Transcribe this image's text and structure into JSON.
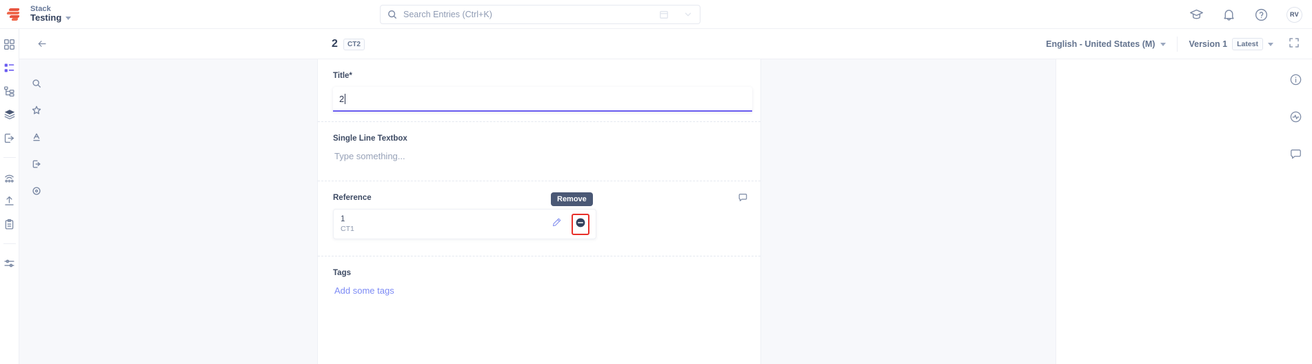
{
  "header": {
    "logo_icon": "contentstack-logo-icon",
    "stack_label": "Stack",
    "stack_name": "Testing",
    "search": {
      "placeholder": "Search Entries (Ctrl+K)",
      "icon": "search-icon"
    },
    "icons": [
      "academy-cap-icon",
      "notification-bell-icon",
      "help-question-icon"
    ],
    "avatar_initials": "RV"
  },
  "subheader": {
    "back_icon": "back-arrow-icon",
    "entry_title": "2",
    "content_type_badge": "CT2",
    "locale": "English - United States (M)",
    "version_label": "Version 1",
    "version_state": "Latest",
    "fullscreen_icon": "fullscreen-icon"
  },
  "left_rail": [
    {
      "name": "sidebar-item-dashboard",
      "icon": "grid-icon"
    },
    {
      "name": "sidebar-item-entries",
      "icon": "list-icon",
      "active": true
    },
    {
      "name": "sidebar-item-content-types",
      "icon": "sitemap-icon"
    },
    {
      "name": "sidebar-item-assets",
      "icon": "layers-icon"
    },
    {
      "name": "sidebar-item-publish",
      "icon": "export-icon"
    },
    {
      "name": "sidebar-item-environments",
      "icon": "globe-pin-icon"
    },
    {
      "name": "sidebar-item-webhooks",
      "icon": "signal-icon"
    },
    {
      "name": "sidebar-item-import",
      "icon": "upload-icon"
    },
    {
      "name": "sidebar-item-tasks",
      "icon": "clipboard-icon"
    },
    {
      "name": "sidebar-item-settings",
      "icon": "sliders-icon"
    }
  ],
  "panel_rail": [
    {
      "name": "panel-search",
      "icon": "search-icon"
    },
    {
      "name": "panel-favorites",
      "icon": "star-icon"
    },
    {
      "name": "panel-text",
      "icon": "text-underline-icon"
    },
    {
      "name": "panel-exit",
      "icon": "logout-icon"
    },
    {
      "name": "panel-location",
      "icon": "map-pin-icon"
    }
  ],
  "right_rail": [
    {
      "name": "entry-info",
      "icon": "info-circle-icon"
    },
    {
      "name": "entry-activity",
      "icon": "activity-pulse-icon"
    },
    {
      "name": "entry-comments",
      "icon": "comment-icon"
    }
  ],
  "form": {
    "title_field": {
      "label": "Title*",
      "value": "2"
    },
    "single_line_field": {
      "label": "Single Line Textbox",
      "placeholder": "Type something..."
    },
    "reference_field": {
      "label": "Reference",
      "comment_icon": "comment-icon",
      "item": {
        "title": "1",
        "subtitle": "CT1"
      },
      "edit_icon": "pencil-icon",
      "remove_icon": "minus-circle-icon",
      "tooltip": "Remove",
      "highlight_color": "#e8302a"
    },
    "tags_field": {
      "label": "Tags",
      "placeholder": "Add some tags"
    }
  }
}
